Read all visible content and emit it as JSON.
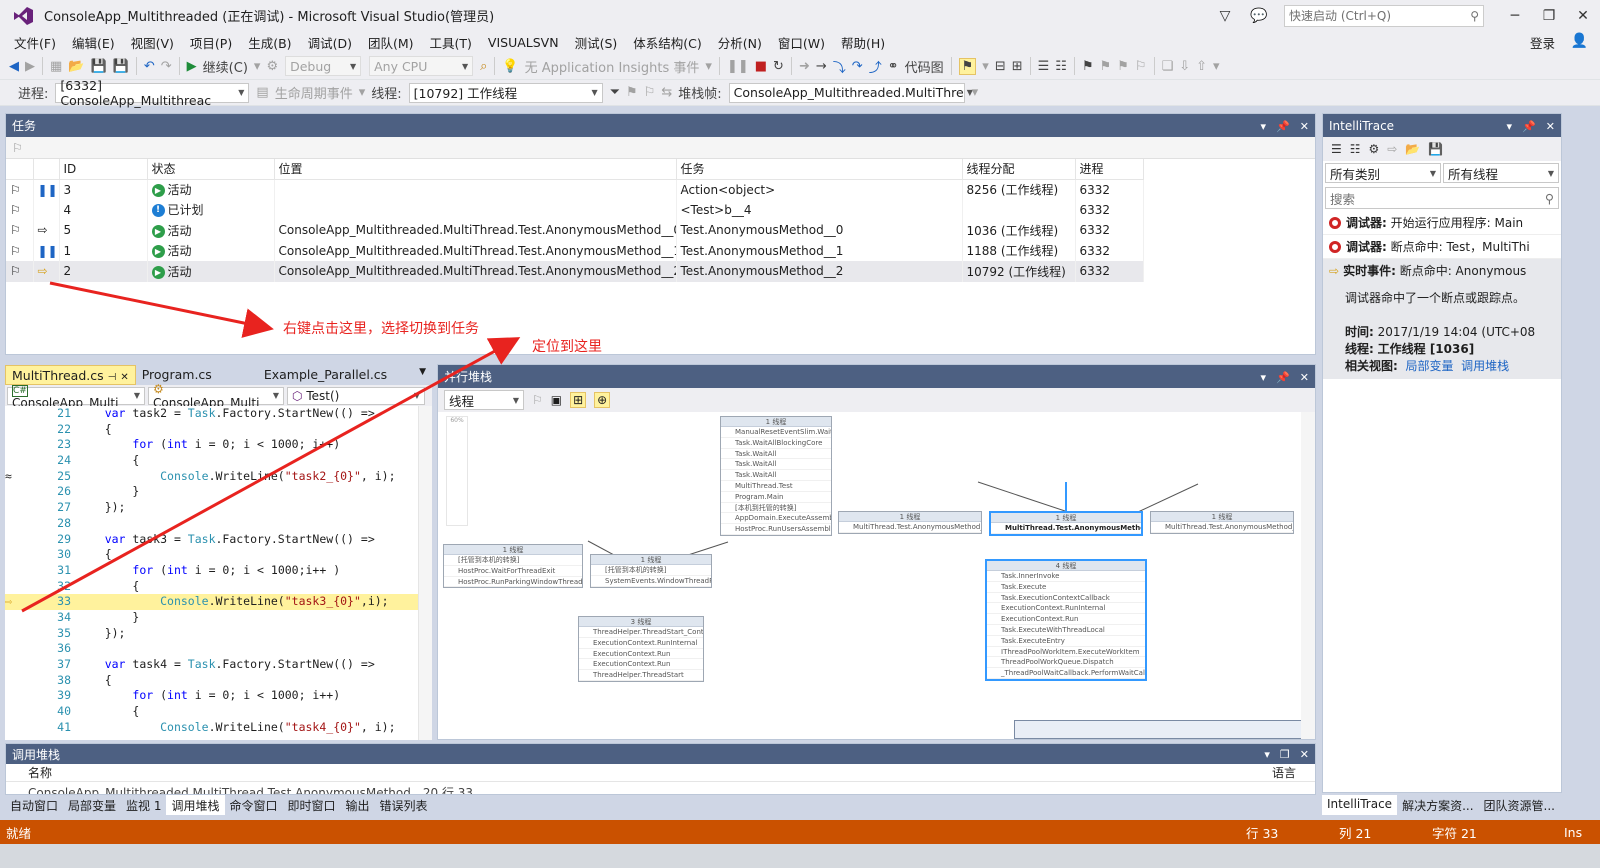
{
  "window": {
    "title": "ConsoleApp_Multithreaded (正在调试) - Microsoft Visual Studio(管理员)",
    "quick_launch_placeholder": "快速启动 (Ctrl+Q)",
    "login": "登录"
  },
  "menu": [
    "文件(F)",
    "编辑(E)",
    "视图(V)",
    "项目(P)",
    "生成(B)",
    "调试(D)",
    "团队(M)",
    "工具(T)",
    "VISUALSVN",
    "测试(S)",
    "体系结构(C)",
    "分析(N)",
    "窗口(W)",
    "帮助(H)"
  ],
  "toolbar1": {
    "continue": "继续(C)",
    "config": "Debug",
    "platform": "Any CPU",
    "insights": "无 Application Insights 事件",
    "code_map": "代码图"
  },
  "toolbar2": {
    "process_label": "进程:",
    "process_value": "[6332] ConsoleApp_Multithreac",
    "lifecycle": "生命周期事件",
    "thread_label": "线程:",
    "thread_value": "[10792] 工作线程",
    "stackframe_label": "堆栈帧:",
    "stackframe_value": "ConsoleApp_Multithreaded.MultiThre"
  },
  "tasks": {
    "title": "任务",
    "columns": [
      "ID",
      "状态",
      "位置",
      "任务",
      "线程分配",
      "进程"
    ],
    "rows": [
      {
        "id": "3",
        "status": "活动",
        "location": "",
        "task": "Action<object>",
        "thread": "8256 (工作线程)",
        "process": "6332"
      },
      {
        "id": "4",
        "status": "已计划",
        "location": "",
        "task": "<Test>b__4",
        "thread": "",
        "process": "6332"
      },
      {
        "id": "5",
        "status": "活动",
        "location": "ConsoleApp_Multithreaded.MultiThread.Test.AnonymousMethod__0",
        "task": "Test.AnonymousMethod__0",
        "thread": "1036 (工作线程)",
        "process": "6332"
      },
      {
        "id": "1",
        "status": "活动",
        "location": "ConsoleApp_Multithreaded.MultiThread.Test.AnonymousMethod__1",
        "task": "Test.AnonymousMethod__1",
        "thread": "1188 (工作线程)",
        "process": "6332"
      },
      {
        "id": "2",
        "status": "活动",
        "location": "ConsoleApp_Multithreaded.MultiThread.Test.AnonymousMethod__2",
        "task": "Test.AnonymousMethod__2",
        "thread": "10792 (工作线程)",
        "process": "6332"
      }
    ]
  },
  "annotations": {
    "right_click": "右键点击这里，选择切换到任务",
    "locate": "定位到这里"
  },
  "editor": {
    "tabs": [
      "MultiThread.cs",
      "Program.cs",
      "Example_Parallel.cs"
    ],
    "nav_project": "ConsoleApp_Multi",
    "nav_class": "ConsoleApp_Multi",
    "nav_member": "Test()",
    "lines": [
      {
        "n": "21",
        "t": "    var task2 = Task.Factory.StartNew(() =>"
      },
      {
        "n": "22",
        "t": "    {"
      },
      {
        "n": "23",
        "t": "        for (int i = 0; i < 1000; i++)"
      },
      {
        "n": "24",
        "t": "        {"
      },
      {
        "n": "25",
        "t": "            Console.WriteLine(\"task2_{0}\", i);"
      },
      {
        "n": "26",
        "t": "        }"
      },
      {
        "n": "27",
        "t": "    });"
      },
      {
        "n": "28",
        "t": ""
      },
      {
        "n": "29",
        "t": "    var task3 = Task.Factory.StartNew(() =>"
      },
      {
        "n": "30",
        "t": "    {"
      },
      {
        "n": "31",
        "t": "        for (int i = 0; i < 1000;i++ )"
      },
      {
        "n": "32",
        "t": "        {"
      },
      {
        "n": "33",
        "t": "            Console.WriteLine(\"task3_{0}\",i);"
      },
      {
        "n": "34",
        "t": "        }"
      },
      {
        "n": "35",
        "t": "    });"
      },
      {
        "n": "36",
        "t": ""
      },
      {
        "n": "37",
        "t": "    var task4 = Task.Factory.StartNew(() =>"
      },
      {
        "n": "38",
        "t": "    {"
      },
      {
        "n": "39",
        "t": "        for (int i = 0; i < 1000; i++)"
      },
      {
        "n": "40",
        "t": "        {"
      },
      {
        "n": "41",
        "t": "            Console.WriteLine(\"task4_{0}\", i);"
      }
    ]
  },
  "parallel_stacks": {
    "title": "并行堆栈",
    "view": "线程",
    "zoom": "60%",
    "nodes": [
      {
        "h": "1 线程",
        "lines": [
          "[托管到本机的转换]",
          "HostProc.WaitForThreadExit",
          "HostProc.RunParkingWindowThread"
        ]
      },
      {
        "h": "1 线程",
        "lines": [
          "[托管到本机的转换]",
          "SystemEvents.WindowThreadProc"
        ]
      },
      {
        "h": "1 线程",
        "lines": [
          "ManualResetEventSlim.Wait",
          "Task.WaitAllBlockingCore",
          "Task.WaitAll",
          "Task.WaitAll",
          "Task.WaitAll",
          "MultiThread.Test",
          "Program.Main",
          "[本机到托管的转换]",
          "AppDomain.ExecuteAssembly",
          "HostProc.RunUsersAssembly"
        ]
      },
      {
        "h": "3 线程",
        "lines": [
          "ThreadHelper.ThreadStart_Context",
          "ExecutionContext.RunInternal",
          "ExecutionContext.Run",
          "ExecutionContext.Run",
          "ThreadHelper.ThreadStart"
        ]
      },
      {
        "h": "1 线程",
        "lines": [
          "MultiThread.Test.AnonymousMethod__1"
        ]
      },
      {
        "h": "1 线程",
        "lines": [
          "MultiThread.Test.AnonymousMethod__2"
        ]
      },
      {
        "h": "1 线程",
        "lines": [
          "MultiThread.Test.AnonymousMethod__0"
        ]
      },
      {
        "h": "4 线程",
        "lines": [
          "Task.InnerInvoke",
          "Task.Execute",
          "Task.ExecutionContextCallback",
          "ExecutionContext.RunInternal",
          "ExecutionContext.Run",
          "Task.ExecuteWithThreadLocal",
          "Task.ExecuteEntry",
          "IThreadPoolWorkItem.ExecuteWorkItem",
          "ThreadPoolWorkQueue.Dispatch",
          "_ThreadPoolWaitCallback.PerformWaitCallback"
        ]
      }
    ]
  },
  "intellitrace": {
    "title": "IntelliTrace",
    "category": "所有类别",
    "threads": "所有线程",
    "search_placeholder": "搜索",
    "events": [
      {
        "label": "调试器:",
        "text": "开始运行应用程序: Main"
      },
      {
        "label": "调试器:",
        "text": "断点命中: Test，MultiThi"
      },
      {
        "label": "实时事件:",
        "text": "断点命中: Anonymous"
      }
    ],
    "detail": {
      "desc": "调试器命中了一个断点或跟踪点。",
      "time_label": "时间:",
      "time_value": "2017/1/19 14:04 (UTC+08",
      "thread_label": "线程:",
      "thread_value": "工作线程 [1036]",
      "views_label": "相关视图:",
      "view1": "局部变量",
      "view2": "调用堆栈"
    }
  },
  "callstack": {
    "title": "调用堆栈",
    "col_name": "名称",
    "col_lang": "语言",
    "row_partial": "ConsoleApp_Multithreaded.MultiThread.Test.AnonymousMethod__20 行 33"
  },
  "bottom_tabs": [
    "自动窗口",
    "局部变量",
    "监视 1",
    "调用堆栈",
    "命令窗口",
    "即时窗口",
    "输出",
    "错误列表"
  ],
  "right_tabs": [
    "IntelliTrace",
    "解决方案资...",
    "团队资源管..."
  ],
  "status": {
    "ready": "就绪",
    "line": "行 33",
    "col": "列 21",
    "char": "字符 21",
    "mode": "Ins"
  },
  "colors": {
    "statusbar": "#ca5100",
    "panel_title": "#4d6082",
    "annotation": "#e8231f"
  }
}
